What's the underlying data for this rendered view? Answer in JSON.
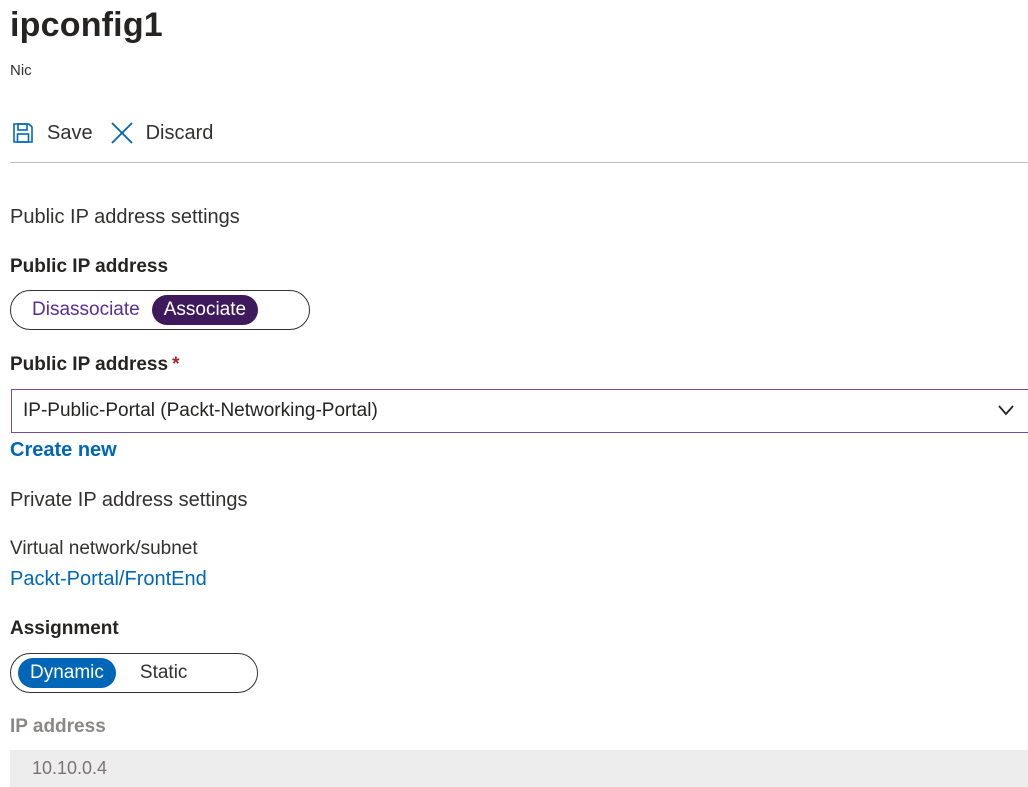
{
  "header": {
    "title": "ipconfig1",
    "subtitle": "Nic"
  },
  "toolbar": {
    "save_label": "Save",
    "discard_label": "Discard"
  },
  "public_ip": {
    "section_title": "Public IP address settings",
    "toggle_label": "Public IP address",
    "toggle_options": [
      "Disassociate",
      "Associate"
    ],
    "toggle_selected": "Associate",
    "select_label": "Public IP address",
    "required_marker": "*",
    "select_value": "IP-Public-Portal (Packt-Networking-Portal)",
    "create_new_label": "Create new"
  },
  "private_ip": {
    "section_title": "Private IP address settings",
    "vnet_label": "Virtual network/subnet",
    "vnet_value": "Packt-Portal/FrontEnd",
    "assignment_label": "Assignment",
    "assignment_options": [
      "Dynamic",
      "Static"
    ],
    "assignment_selected": "Dynamic",
    "ip_label": "IP address",
    "ip_value": "10.10.0.4"
  },
  "icons": {
    "save": "save-icon",
    "discard": "close-icon",
    "select": "chevron-down-icon"
  },
  "colors": {
    "link": "#0067b8",
    "associate_selected": "#3e1a5c",
    "dynamic_selected": "#0067b8",
    "required": "#a4262c",
    "disabled_field": "#ededed"
  }
}
